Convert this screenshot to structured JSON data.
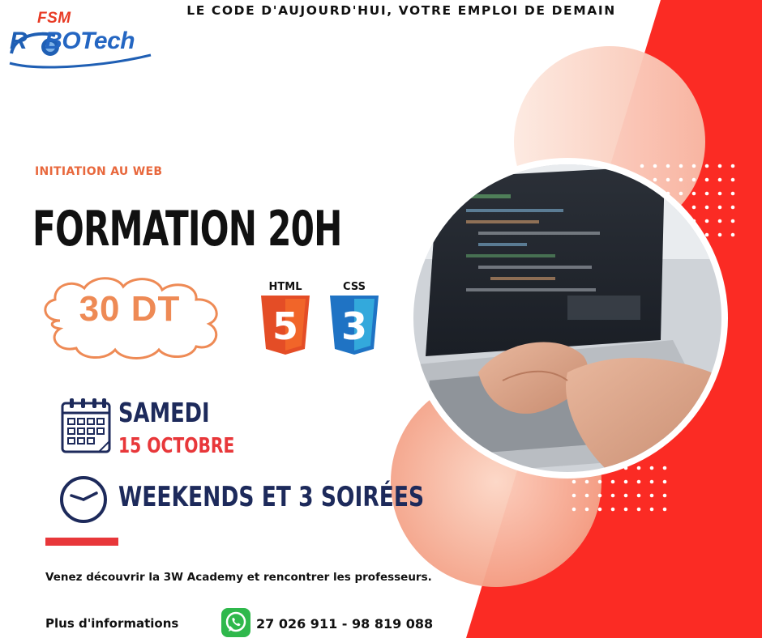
{
  "header": {
    "logo_top": "FSM",
    "logo_word_a": "R",
    "logo_word_b": "BOTech",
    "tagline": "LE CODE D'AUJOURD'HUI, VOTRE EMPLOI DE DEMAIN"
  },
  "main": {
    "subtitle": "INITIATION AU WEB",
    "title": "FORMATION 20H",
    "price": "30 DT",
    "badges": [
      {
        "label": "HTML",
        "number": "5",
        "color": "#e44d26",
        "icon": "html5-icon"
      },
      {
        "label": "CSS",
        "number": "3",
        "color": "#1f73c4",
        "icon": "css3-icon"
      }
    ]
  },
  "schedule": {
    "day": "SAMEDI",
    "date": "15 OCTOBRE",
    "sessions": "WEEKENDS ET 3 SOIRÉES",
    "calendar_icon": "calendar-icon",
    "clock_icon": "clock-icon"
  },
  "footer": {
    "description": "Venez découvrir la 3W Academy et rencontrer les professeurs.",
    "more_info": "Plus d'informations",
    "phone": "27 026 911 - 98 819 088",
    "phone_icon": "whatsapp-icon"
  },
  "colors": {
    "accent_red": "#fb2b24",
    "peach": "#fcdccf",
    "navy": "#1d2a5b",
    "orange": "#ee8a55"
  }
}
